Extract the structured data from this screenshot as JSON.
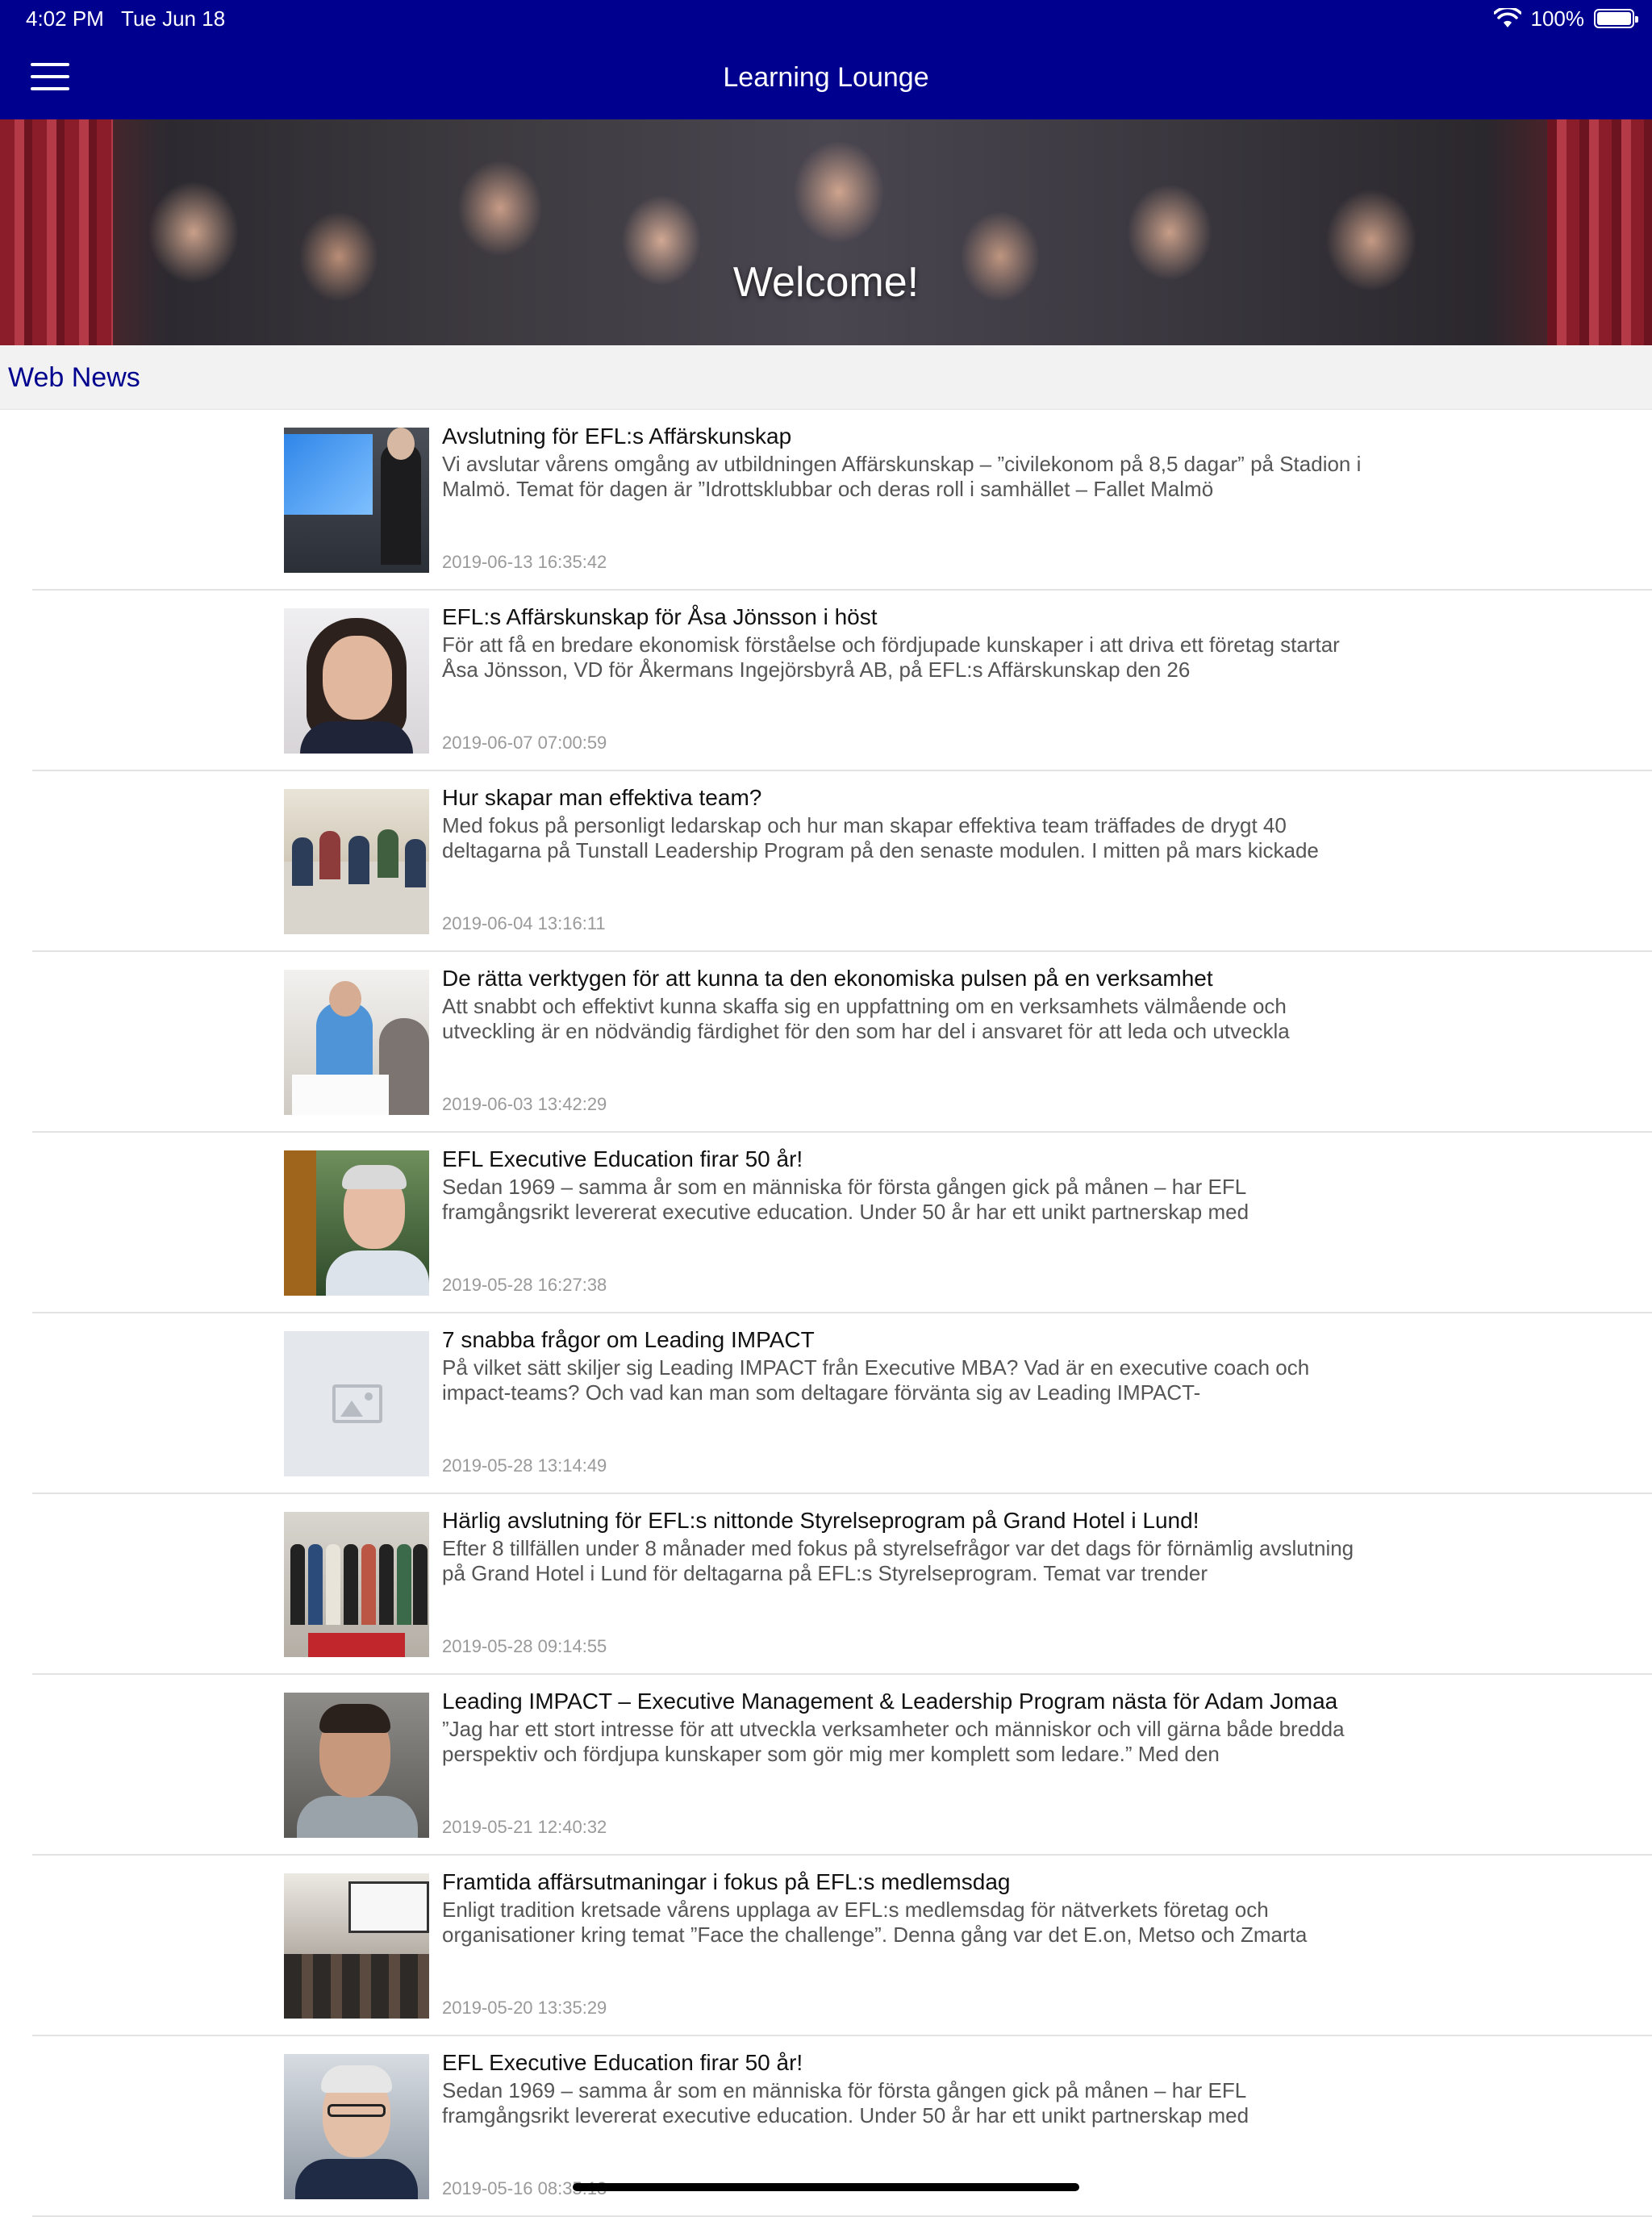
{
  "status_bar": {
    "time": "4:02 PM",
    "date": "Tue Jun 18",
    "battery": "100%"
  },
  "header": {
    "title": "Learning Lounge"
  },
  "hero": {
    "title": "Welcome!"
  },
  "section": {
    "title": "Web News"
  },
  "news": [
    {
      "title": "Avslutning för EFL:s Affärskunskap",
      "summary": "Vi avslutar vårens omgång av utbildningen Affärskunskap – ”civilekonom på 8,5 dagar” på Stadion i Malmö. Temat för dagen är ”Idrottsklubbar och deras roll i samhället – Fallet Malmö",
      "date": "2019-06-13 16:35:42"
    },
    {
      "title": "EFL:s Affärskunskap för Åsa Jönsson i höst",
      "summary": "För att få en bredare ekonomisk förståelse och fördjupade kunskaper i att driva ett företag startar Åsa Jönsson, VD för Åkermans Ingejörsbyrå AB, på EFL:s Affärskunskap den 26",
      "date": "2019-06-07 07:00:59"
    },
    {
      "title": "Hur skapar man effektiva team?",
      "summary": "Med fokus på personligt ledarskap och hur man skapar effektiva team träffades de drygt 40 deltagarna på Tunstall Leadership Program på den senaste modulen. I mitten på mars kickade",
      "date": "2019-06-04 13:16:11"
    },
    {
      "title": "De rätta verktygen för att kunna ta den ekonomiska pulsen på en verksamhet",
      "summary": "Att snabbt och effektivt kunna skaffa sig en uppfattning om en verksamhets välmående och utveckling är en nödvändig färdighet för den som har del i ansvaret för att leda och utveckla",
      "date": "2019-06-03 13:42:29"
    },
    {
      "title": "EFL Executive Education firar 50 år!",
      "summary": "Sedan 1969 – samma år som en människa för första gången gick på månen – har EFL framgångsrikt levererat executive education. Under 50 år har ett unikt partnerskap med",
      "date": "2019-05-28 16:27:38"
    },
    {
      "title": "7 snabba frågor om Leading IMPACT",
      "summary": "På vilket sätt skiljer sig Leading IMPACT från Executive MBA? Vad är en executive coach och impact-teams? Och vad kan man som deltagare förvänta sig av Leading IMPACT-",
      "date": "2019-05-28 13:14:49"
    },
    {
      "title": "Härlig avslutning för EFL:s nittonde Styrelseprogram på Grand Hotel i Lund!",
      "summary": "Efter 8 tillfällen under 8 månader med fokus på styrelsefrågor var det dags för förnämlig avslutning på Grand Hotel i Lund för deltagarna på EFL:s Styrelseprogram. Temat var trender",
      "date": "2019-05-28 09:14:55"
    },
    {
      "title": "Leading IMPACT – Executive Management & Leadership Program nästa för Adam Jomaa",
      "summary": "”Jag har ett stort intresse för att utveckla verksamheter och människor och vill gärna både bredda perspektiv och fördjupa kunskaper som gör mig mer komplett som ledare.” Med den",
      "date": "2019-05-21 12:40:32"
    },
    {
      "title": "Framtida affärsutmaningar i fokus på EFL:s medlemsdag",
      "summary": "Enligt tradition kretsade vårens upplaga av EFL:s medlemsdag för nätverkets företag och organisationer kring temat ”Face the challenge”. Denna gång var det E.on, Metso och Zmarta",
      "date": "2019-05-20 13:35:29"
    },
    {
      "title": "EFL Executive Education firar 50 år!",
      "summary": "Sedan 1969 – samma år som en människa för första gången gick på månen – har EFL framgångsrikt levererat executive education. Under 50 år har ett unikt partnerskap med",
      "date": "2019-05-16 08:35:13"
    }
  ]
}
